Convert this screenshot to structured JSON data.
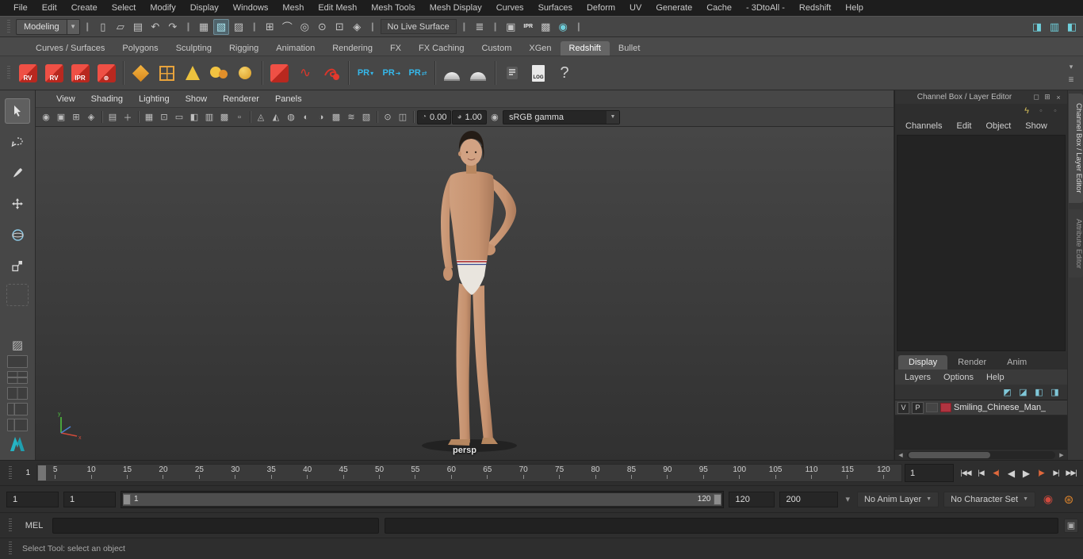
{
  "menubar": {
    "items": [
      "File",
      "Edit",
      "Create",
      "Select",
      "Modify",
      "Display",
      "Windows",
      "Mesh",
      "Edit Mesh",
      "Mesh Tools",
      "Mesh Display",
      "Curves",
      "Surfaces",
      "Deform",
      "UV",
      "Generate",
      "Cache",
      "- 3DtoAll -",
      "Redshift",
      "Help"
    ]
  },
  "status_line": {
    "menu_set": "Modeling",
    "live_surface": "No Live Surface",
    "ipr_label": "IPR"
  },
  "shelf": {
    "tabs": [
      "Curves / Surfaces",
      "Polygons",
      "Sculpting",
      "Rigging",
      "Animation",
      "Rendering",
      "FX",
      "FX Caching",
      "Custom",
      "XGen",
      "Redshift",
      "Bullet"
    ],
    "labels": {
      "rv": "RV",
      "ipr": "IPR",
      "pr": "PR",
      "log": "LOG",
      "help": "?"
    }
  },
  "viewport": {
    "menus": [
      "View",
      "Shading",
      "Lighting",
      "Show",
      "Renderer",
      "Panels"
    ],
    "exposure": "0.00",
    "gamma": "1.00",
    "color_space": "sRGB gamma",
    "camera": "persp"
  },
  "channel_box": {
    "title": "Channel Box / Layer Editor",
    "menus": [
      "Channels",
      "Edit",
      "Object",
      "Show"
    ],
    "side_tab_top": "Channel Box / Layer Editor",
    "side_tab_bottom": "Attribute Editor"
  },
  "layer_editor": {
    "tabs": [
      "Display",
      "Render",
      "Anim"
    ],
    "menus": [
      "Layers",
      "Options",
      "Help"
    ],
    "layer": {
      "visible": "V",
      "playback": "P",
      "name": "Smiling_Chinese_Man_"
    }
  },
  "time_slider": {
    "ticks": [
      "5",
      "10",
      "15",
      "20",
      "25",
      "30",
      "35",
      "40",
      "45",
      "50",
      "55",
      "60",
      "65",
      "70",
      "75",
      "80",
      "85",
      "90",
      "95",
      "100",
      "105",
      "110",
      "115",
      "120"
    ],
    "current_frame": "1",
    "current_time": "1"
  },
  "range_slider": {
    "anim_start": "1",
    "playback_start": "1",
    "bar_start": "1",
    "bar_end": "120",
    "playback_end": "120",
    "anim_end": "200",
    "anim_layer": "No Anim Layer",
    "character_set": "No Character Set"
  },
  "command_line": {
    "label": "MEL"
  },
  "help_line": {
    "text": "Select Tool: select an object"
  }
}
